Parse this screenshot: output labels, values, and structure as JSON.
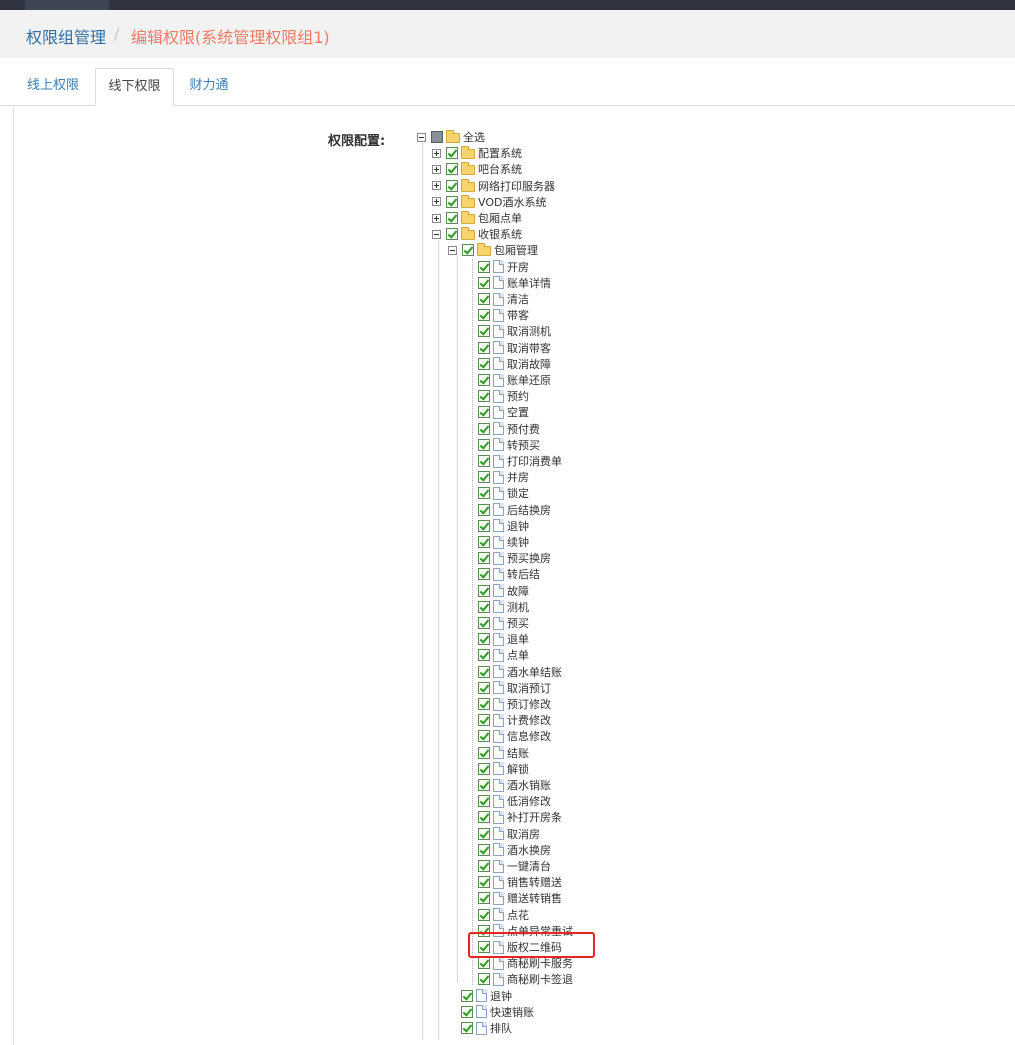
{
  "breadcrumb": {
    "first": "权限组管理",
    "separator": "/",
    "active": "编辑权限(系统管理权限组1)"
  },
  "tabs": [
    "线上权限",
    "线下权限",
    "财力通"
  ],
  "active_tab": "线下权限",
  "config_label": "权限配置:",
  "tree": {
    "root": "全选",
    "systems": [
      "配置系统",
      "吧台系统",
      "网络打印服务器",
      "VOD酒水系统",
      "包厢点单",
      "收银系统"
    ],
    "room_group": "包厢管理",
    "room_items": [
      "开房",
      "账单详情",
      "清洁",
      "带客",
      "取消测机",
      "取消带客",
      "取消故障",
      "账单还原",
      "预约",
      "空置",
      "预付费",
      "转预买",
      "打印消费单",
      "并房",
      "锁定",
      "后结换房",
      "退钟",
      "续钟",
      "预买换房",
      "转后结",
      "故障",
      "测机",
      "预买",
      "退单",
      "点单",
      "酒水单结账",
      "取消预订",
      "预订修改",
      "计费修改",
      "信息修改",
      "结账",
      "解锁",
      "酒水销账",
      "低消修改",
      "补打开房条",
      "取消房",
      "酒水换房",
      "一键清台",
      "销售转赠送",
      "赠送转销售",
      "点花",
      "点单异常重试",
      "版权二维码",
      "商秘刷卡服务",
      "商秘刷卡签退"
    ],
    "cashier_items": [
      "退钟",
      "快速销账",
      "排队"
    ]
  },
  "colors": {
    "link": "#2f6fa3",
    "active_crumb": "#ee7a64",
    "highlight_box": "#e8261f"
  }
}
